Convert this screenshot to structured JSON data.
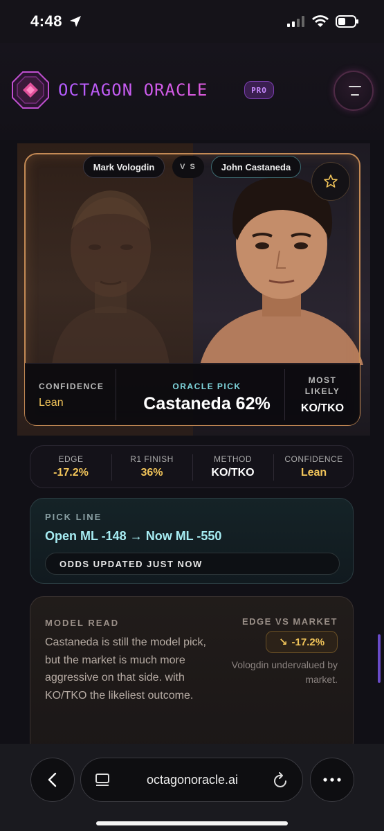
{
  "status_bar": {
    "time": "4:48"
  },
  "header": {
    "brand": "OCTAGON ORACLE",
    "badge": "PRO"
  },
  "fight": {
    "fighter_a": "Mark Vologdin",
    "vs": "V S",
    "fighter_b": "John Castaneda",
    "confidence_label": "CONFIDENCE",
    "confidence_value": "Lean",
    "pick_label": "ORACLE PICK",
    "pick_value": "Castaneda 62%",
    "most_likely_label_1": "MOST",
    "most_likely_label_2": "LIKELY",
    "most_likely_value": "KO/TKO"
  },
  "metrics": [
    {
      "label": "EDGE",
      "value": "-17.2%",
      "color": "#f2c55a"
    },
    {
      "label": "R1 FINISH",
      "value": "36%",
      "color": "#f2c55a"
    },
    {
      "label": "METHOD",
      "value": "KO/TKO",
      "color": "#ffffff"
    },
    {
      "label": "CONFIDENCE",
      "value": "Lean",
      "color": "#f2c55a"
    }
  ],
  "pick_line": {
    "label": "PICK LINE",
    "value": "Open ML -148 → Now ML -550",
    "chip": "ODDS UPDATED JUST NOW"
  },
  "model_read": {
    "label": "MODEL READ",
    "text": "Castaneda is still the model pick, but the market is much more aggressive on that side. with KO/TKO the likeliest outcome.",
    "edge_label": "EDGE VS MARKET",
    "edge_arrow": "↘",
    "edge_value": "-17.2%",
    "undervalued": "Vologdin undervalued by market."
  },
  "browser": {
    "url": "octagonoracle.ai"
  },
  "icons": [
    "location-arrow-icon",
    "signal-icon",
    "wifi-icon",
    "battery-icon",
    "octagon-logo-icon",
    "hamburger-icon",
    "star-icon",
    "back-chevron-icon",
    "tabs-icon",
    "reload-icon",
    "more-icon"
  ],
  "colors": {
    "accent_purple": "#b25cff",
    "gold": "#f2c55a",
    "cyan": "#a6ecf2",
    "frame_orange": "#c48a55"
  }
}
